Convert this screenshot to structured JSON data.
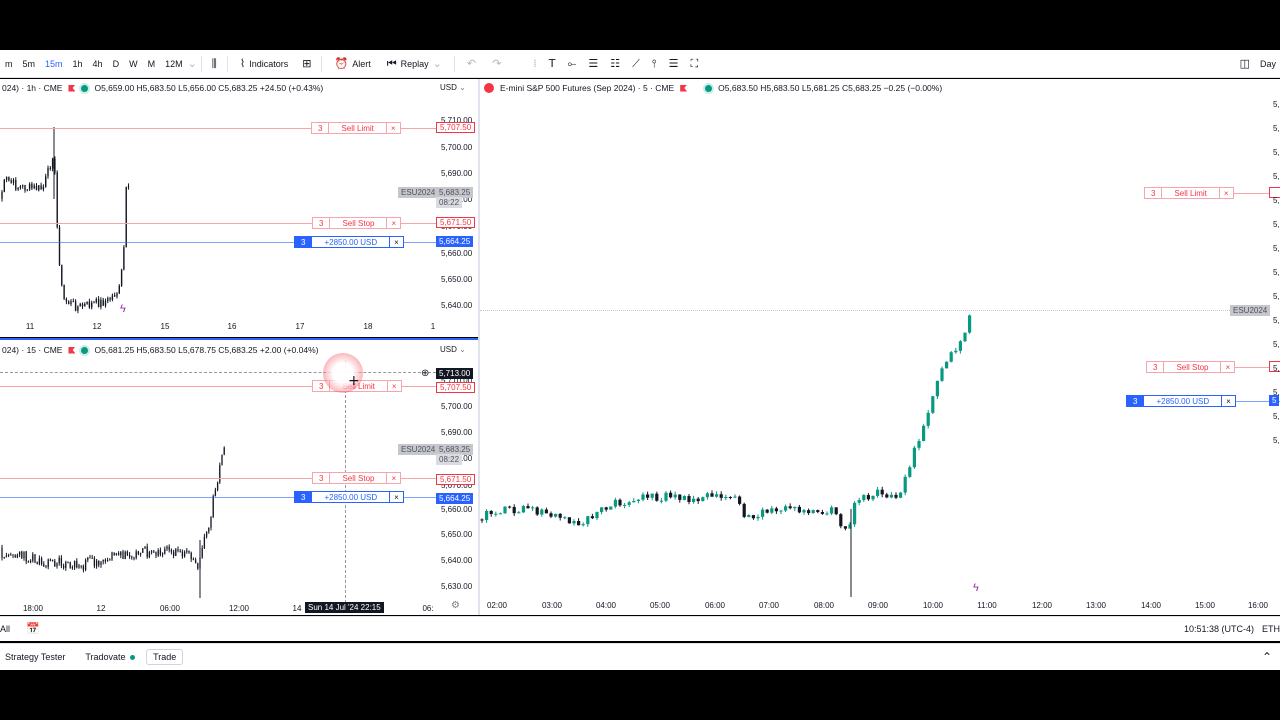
{
  "toolbar": {
    "timeframes": [
      "m",
      "5m",
      "15m",
      "1h",
      "4h",
      "D",
      "W",
      "M",
      "12M"
    ],
    "active_timeframe": "15m",
    "indicators_label": "Indicators",
    "alert_label": "Alert",
    "replay_label": "Replay",
    "right_label": "Day"
  },
  "chart_top_left": {
    "header_symbol": "024) · 1h · CME",
    "ohlc": "O5,659.00 H5,683.50 L5,656.00 C5,683.25 +24.50 (+0.43%)",
    "currency": "USD",
    "price_axis": [
      "5,710.00",
      "5,700.00",
      "5,690.00",
      "5,680.00",
      "5,670.00",
      "5,660.00",
      "5,650.00",
      "5,640.00"
    ],
    "time_axis": [
      "11",
      "12",
      "15",
      "16",
      "17",
      "18",
      "1"
    ],
    "symbol_tag": "ESU2024",
    "last_price": "5,683.25",
    "countdown": "08:22",
    "orders": {
      "sell_limit": {
        "qty": "3",
        "label": "Sell Limit",
        "price": "5,707.50"
      },
      "sell_stop": {
        "qty": "3",
        "label": "Sell Stop",
        "price": "5,671.50"
      },
      "position": {
        "qty": "3",
        "label": "+2850.00 USD",
        "price": "5,664.25"
      }
    }
  },
  "chart_bottom_left": {
    "header_symbol": "024) · 15 · CME",
    "ohlc": "O5,681.25 H5,683.50 L5,678.75 C5,683.25 +2.00 (+0.04%)",
    "currency": "USD",
    "price_axis": [
      "5,710.00",
      "5,700.00",
      "5,690.00",
      "5,680.00",
      "5,670.00",
      "5,660.00",
      "5,650.00",
      "5,640.00",
      "5,630.00"
    ],
    "time_axis": [
      "18:00",
      "12",
      "06:00",
      "12:00",
      "14",
      "06:"
    ],
    "crosshair_price": "5,713.00",
    "crosshair_time": "Sun 14 Jul '24   22:15",
    "symbol_tag": "ESU2024",
    "last_price": "5,683.25",
    "countdown": "08:22",
    "orders": {
      "sell_limit": {
        "qty": "3",
        "label": "Sell Limit",
        "price": "5,707.50"
      },
      "sell_stop": {
        "qty": "3",
        "label": "Sell Stop",
        "price": "5,671.50"
      },
      "position": {
        "qty": "3",
        "label": "+2850.00 USD",
        "price": "5,664.25"
      }
    }
  },
  "chart_right": {
    "title": "E-mini S&P 500 Futures (Sep 2024) · 5 · CME",
    "ohlc": "O5,683.50 H5,683.50 L5,681.25 C5,683.25 −0.25 (−0.00%)",
    "time_axis": [
      "02:00",
      "03:00",
      "04:00",
      "05:00",
      "06:00",
      "07:00",
      "08:00",
      "09:00",
      "10:00",
      "11:00",
      "12:00",
      "13:00",
      "14:00",
      "15:00",
      "16:00"
    ],
    "price_axis_partial": [
      "5,",
      "5,",
      "5,",
      "5,",
      "5,",
      "5,",
      "5,",
      "5,",
      "5,",
      "5,",
      "5,",
      "5,",
      "5,",
      "5,",
      "5,"
    ],
    "symbol_tag": "ESU2024",
    "orders": {
      "sell_limit": {
        "qty": "3",
        "label": "Sell Limit"
      },
      "sell_stop": {
        "qty": "3",
        "label": "Sell Stop"
      },
      "position": {
        "qty": "3",
        "label": "+2850.00 USD",
        "price": "5"
      }
    }
  },
  "statusbar": {
    "left_label": "All",
    "clock": "10:51:38 (UTC-4)",
    "session": "ETH"
  },
  "bottombar": {
    "tabs": [
      "Strategy Tester",
      "Tradovate",
      "Trade"
    ],
    "active_tab": "Trade"
  },
  "colors": {
    "bull": "#089981",
    "bear": "#f23645",
    "accent": "#2962ff",
    "candle_dark": "#131722"
  }
}
